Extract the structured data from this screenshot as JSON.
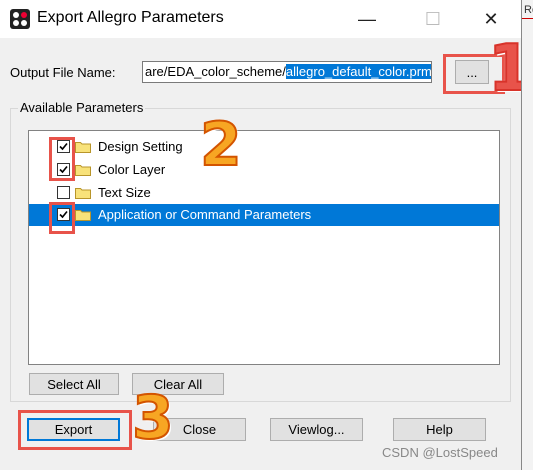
{
  "window": {
    "title": "Export Allegro Parameters"
  },
  "controls": {
    "minimize": "—",
    "maximize": "☐",
    "close": "✕"
  },
  "peek_text": "Ro",
  "output": {
    "label": "Output File Name:",
    "path_prefix": "are/EDA_color_scheme/",
    "path_selected": "allegro_default_color.prm",
    "browse_label": "..."
  },
  "group": {
    "title": "Available Parameters",
    "items": [
      {
        "label": "Design Setting",
        "checked": true,
        "selected": false
      },
      {
        "label": "Color Layer",
        "checked": true,
        "selected": false
      },
      {
        "label": "Text Size",
        "checked": false,
        "selected": false
      },
      {
        "label": "Application or Command Parameters",
        "checked": true,
        "selected": true
      }
    ],
    "select_all_label": "Select All",
    "clear_all_label": "Clear All"
  },
  "footer": {
    "export_label": "Export",
    "close_label": "Close",
    "viewlog_label": "Viewlog...",
    "help_label": "Help"
  },
  "annotations": {
    "one": "1",
    "two": "2",
    "three": "3"
  },
  "watermark": "CSDN @LostSpeed",
  "colors": {
    "selection": "#0078d7",
    "annotation_box": "#e8534a",
    "annotation_number": "#f7a623"
  }
}
